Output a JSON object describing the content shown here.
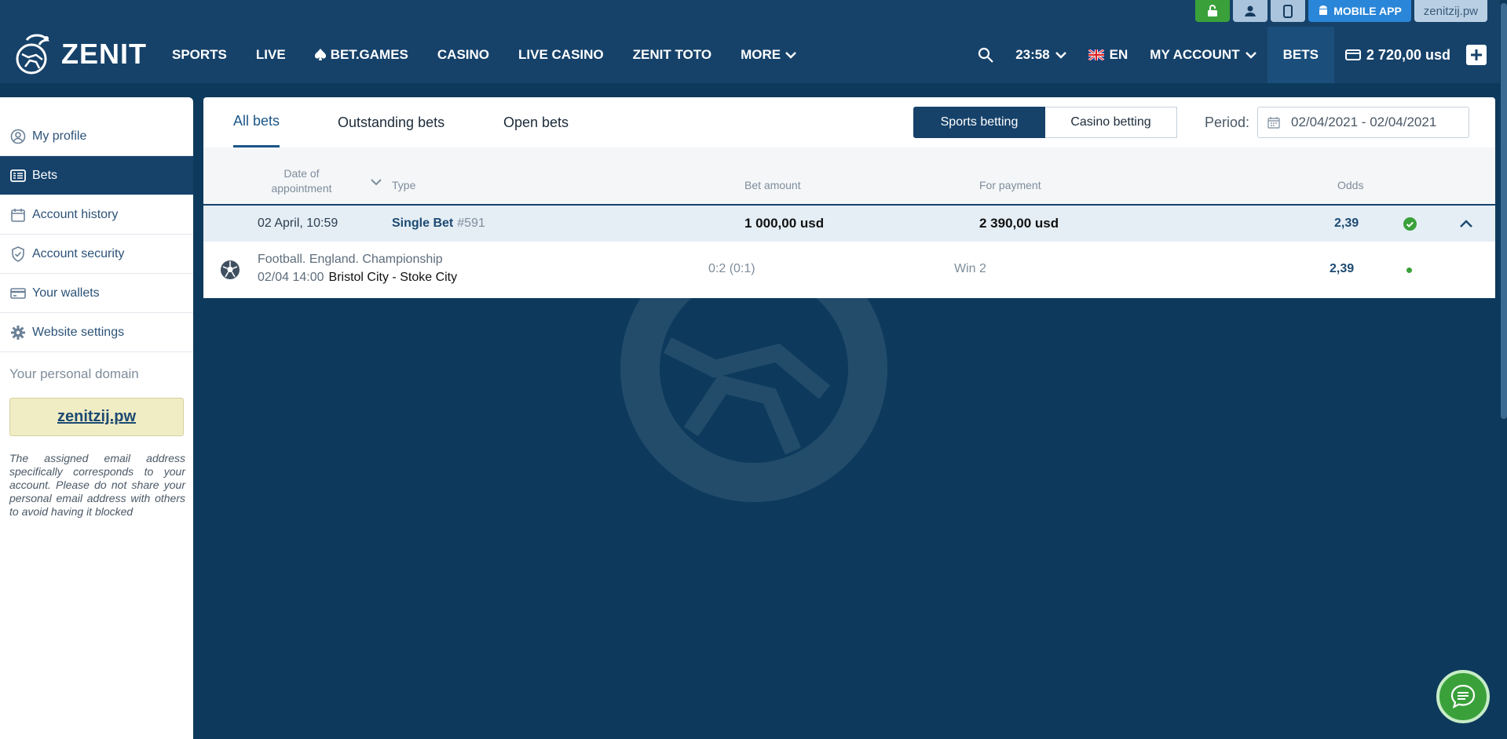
{
  "utility_bar": {
    "mobile_app_label": "MOBILE APP",
    "domain_label": "zenitzij.pw"
  },
  "header": {
    "logo_text": "ZENIT",
    "nav": [
      "SPORTS",
      "LIVE",
      "BET.GAMES",
      "CASINO",
      "LIVE CASINO",
      "ZENIT TOTO",
      "MORE"
    ],
    "time": "23:58",
    "language": "EN",
    "my_account": "MY ACCOUNT",
    "bets": "BETS",
    "balance": "2 720,00 usd"
  },
  "sidebar": {
    "items": [
      {
        "label": "My profile"
      },
      {
        "label": "Bets"
      },
      {
        "label": "Account history"
      },
      {
        "label": "Account security"
      },
      {
        "label": "Your wallets"
      },
      {
        "label": "Website settings"
      }
    ],
    "active_index": 1,
    "domain_heading": "Your personal domain",
    "domain": "zenitzij.pw",
    "domain_note": "The assigned email address specifically corresponds to your account. Please do not share your personal email address with others to avoid having it blocked"
  },
  "main": {
    "tabs": [
      "All bets",
      "Outstanding bets",
      "Open bets"
    ],
    "active_tab": 0,
    "segment": [
      "Sports betting",
      "Casino betting"
    ],
    "active_segment": 0,
    "period_label": "Period:",
    "period_value": "02/04/2021 - 02/04/2021",
    "columns": {
      "date": "Date of appointment",
      "type": "Type",
      "bet_amount": "Bet amount",
      "for_payment": "For payment",
      "odds": "Odds"
    },
    "bets": [
      {
        "date": "02 April, 10:59",
        "type": "Single Bet",
        "number": "#591",
        "bet_amount": "1 000,00 usd",
        "for_payment": "2 390,00 usd",
        "odds": "2,39",
        "status": "won",
        "events": [
          {
            "league": "Football. England. Championship",
            "datetime": "02/04 14:00",
            "teams": "Bristol City - Stoke City",
            "score": "0:2 (0:1)",
            "outcome": "Win 2",
            "odds": "2,39"
          }
        ]
      }
    ]
  },
  "colors": {
    "header_bg": "#16426a",
    "page_bg": "#0d3a5c",
    "accent_green": "#3aa13a",
    "app_blue": "#2a86d8"
  }
}
